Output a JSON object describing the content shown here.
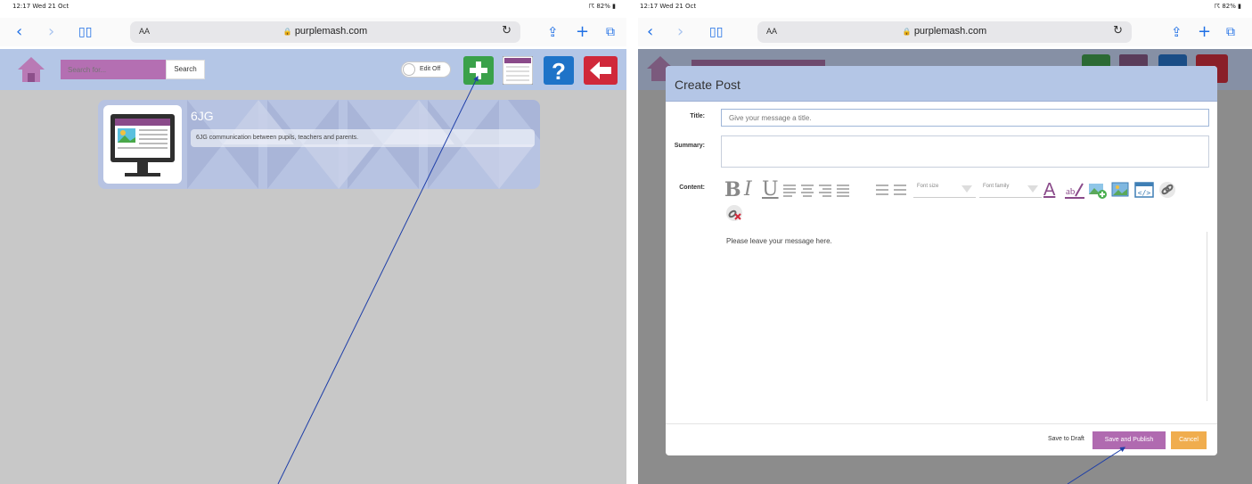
{
  "left": {
    "status": {
      "time": "12:17  Wed 21 Oct",
      "battery": "☈ 82% ▮"
    },
    "browser": {
      "text_size": "AA",
      "url": "purplemash.com"
    },
    "toolbar": {
      "search_placeholder": "Search for...",
      "search_button": "Search",
      "edit_toggle": "Edit Off"
    },
    "card": {
      "title": "6JG",
      "description": "6JG communication between pupils, teachers and parents."
    }
  },
  "right": {
    "status": {
      "time": "12:17  Wed 21 Oct",
      "battery": "☈ 82% ▮"
    },
    "browser": {
      "text_size": "AA",
      "url": "purplemash.com"
    },
    "modal": {
      "title": "Create Post",
      "title_label": "Title:",
      "title_placeholder": "Give your message a title.",
      "summary_label": "Summary:",
      "content_label": "Content:",
      "toolbar": {
        "bold": "B",
        "italic": "I",
        "underline": "U",
        "font_size": "Font size",
        "font_family": "Font family",
        "font_color": "A"
      },
      "content_text": "Please leave your message here.",
      "save_draft": "Save to Draft",
      "save_publish": "Save and Publish",
      "cancel": "Cancel"
    }
  },
  "colors": {
    "toolbar": "#b4c6e6",
    "purple": "#b06ab0",
    "plus_green": "#3aa14a",
    "help_blue": "#1e73c8",
    "back_red": "#d0283a",
    "cancel_orange": "#f0ad4e",
    "arrow": "#1f3fa8"
  }
}
